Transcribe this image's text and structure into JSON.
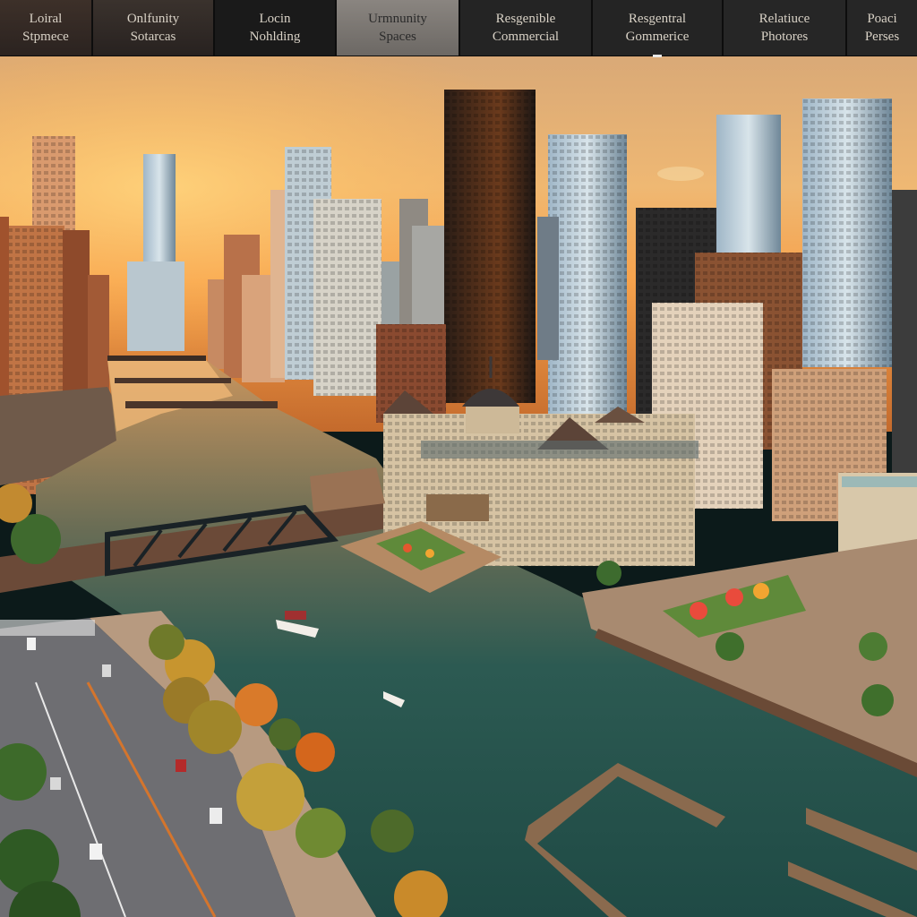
{
  "tabs": [
    {
      "line1": "Loiral",
      "line2": "Stpmece"
    },
    {
      "line1": "Onlfunity",
      "line2": "Sotarcas"
    },
    {
      "line1": "Locin",
      "line2": "Nohlding"
    },
    {
      "line1": "Urmnunity",
      "line2": "Spaces",
      "active": true
    },
    {
      "line1": "Resgenible",
      "line2": "Commercial"
    },
    {
      "line1": "Resgentral",
      "line2": "Gommerice"
    },
    {
      "line1": "Relatiuce",
      "line2": "Photores"
    },
    {
      "line1": "Poaci",
      "line2": "Perses"
    }
  ],
  "image": {
    "icon": "city-waterfront-photo"
  },
  "colors": {
    "sky_top": "#e9a86a",
    "sky_glow": "#f6b25a",
    "water": "#24554f",
    "bar": "#1b1b1b"
  }
}
